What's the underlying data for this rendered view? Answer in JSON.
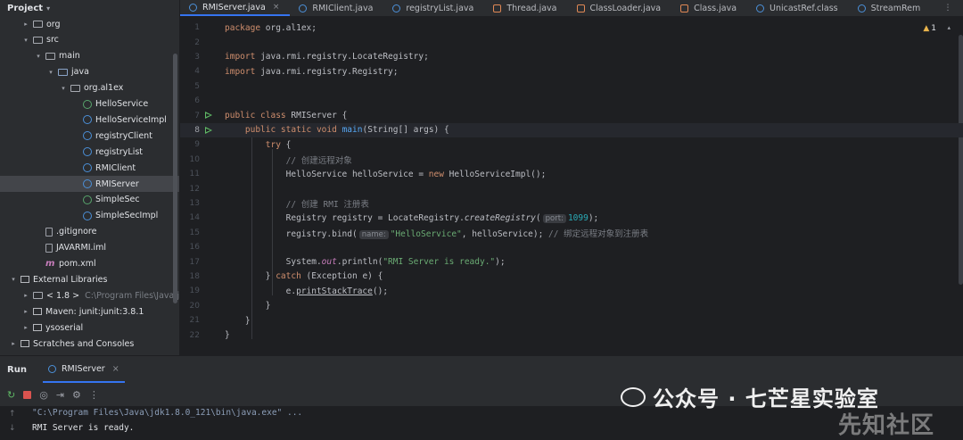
{
  "project": {
    "title": "Project",
    "tree": [
      {
        "label": "org",
        "icon": "folder-icon",
        "indent": 1,
        "arrow": "right",
        "name": "tree-org"
      },
      {
        "label": "src",
        "icon": "folder-icon",
        "indent": 1,
        "arrow": "down",
        "name": "tree-src"
      },
      {
        "label": "main",
        "icon": "folder-icon",
        "indent": 2,
        "arrow": "down",
        "name": "tree-main"
      },
      {
        "label": "java",
        "icon": "source-folder-icon",
        "indent": 3,
        "arrow": "down",
        "name": "tree-java"
      },
      {
        "label": "org.al1ex",
        "icon": "package-icon",
        "indent": 4,
        "arrow": "down",
        "name": "tree-package"
      },
      {
        "label": "HelloService",
        "icon": "interface-icon",
        "indent": 5,
        "arrow": "",
        "name": "tree-HelloService"
      },
      {
        "label": "HelloServiceImpl",
        "icon": "class-icon",
        "indent": 5,
        "arrow": "",
        "name": "tree-HelloServiceImpl"
      },
      {
        "label": "registryClient",
        "icon": "class-icon",
        "indent": 5,
        "arrow": "",
        "name": "tree-registryClient"
      },
      {
        "label": "registryList",
        "icon": "class-icon",
        "indent": 5,
        "arrow": "",
        "name": "tree-registryList"
      },
      {
        "label": "RMIClient",
        "icon": "class-icon",
        "indent": 5,
        "arrow": "",
        "name": "tree-RMIClient"
      },
      {
        "label": "RMIServer",
        "icon": "class-icon",
        "indent": 5,
        "arrow": "",
        "name": "tree-RMIServer",
        "selected": true
      },
      {
        "label": "SimpleSec",
        "icon": "interface-icon",
        "indent": 5,
        "arrow": "",
        "name": "tree-SimpleSec"
      },
      {
        "label": "SimpleSecImpl",
        "icon": "class-icon",
        "indent": 5,
        "arrow": "",
        "name": "tree-SimpleSecImpl"
      },
      {
        "label": ".gitignore",
        "icon": "gitignore-icon",
        "indent": 2,
        "arrow": "",
        "name": "tree-gitignore"
      },
      {
        "label": "JAVARMI.iml",
        "icon": "file-icon",
        "indent": 2,
        "arrow": "",
        "name": "tree-iml"
      },
      {
        "label": "pom.xml",
        "icon": "maven-icon",
        "indent": 2,
        "arrow": "",
        "name": "tree-pom"
      },
      {
        "label": "External Libraries",
        "icon": "library-icon",
        "indent": 0,
        "arrow": "down",
        "name": "tree-external-libraries"
      },
      {
        "label": "< 1.8 >",
        "dim": "C:\\Program Files\\Java\\jdk1",
        "icon": "jdk-icon",
        "indent": 1,
        "arrow": "right",
        "name": "tree-jdk"
      },
      {
        "label": "Maven: junit:junit:3.8.1",
        "icon": "library-icon",
        "indent": 1,
        "arrow": "right",
        "name": "tree-junit"
      },
      {
        "label": "ysoserial",
        "icon": "library-icon",
        "indent": 1,
        "arrow": "right",
        "name": "tree-ysoserial"
      },
      {
        "label": "Scratches and Consoles",
        "icon": "scratches-icon",
        "indent": 0,
        "arrow": "right",
        "name": "tree-scratches"
      }
    ]
  },
  "tabs": [
    {
      "label": "RMIServer.java",
      "active": true,
      "close": "×",
      "icon": "class-icon"
    },
    {
      "label": "RMIClient.java",
      "active": false,
      "icon": "class-icon"
    },
    {
      "label": "registryList.java",
      "active": false,
      "icon": "class-icon"
    },
    {
      "label": "Thread.java",
      "active": false,
      "icon": "class-file-icon"
    },
    {
      "label": "ClassLoader.java",
      "active": false,
      "icon": "class-file-icon"
    },
    {
      "label": "Class.java",
      "active": false,
      "icon": "class-file-icon"
    },
    {
      "label": "UnicastRef.class",
      "active": false,
      "icon": "class-icon"
    },
    {
      "label": "StreamRem",
      "active": false,
      "icon": "class-icon"
    }
  ],
  "editor": {
    "warnings": "1",
    "current_line": 8,
    "lines": [
      [
        [
          "kw",
          "package"
        ],
        [
          "",
          "org.al1ex;"
        ]
      ],
      [],
      [
        [
          "kw",
          "import"
        ],
        [
          "",
          "java.rmi.registry.LocateRegistry;"
        ]
      ],
      [
        [
          "kw",
          "import"
        ],
        [
          "",
          "java.rmi.registry.Registry;"
        ]
      ],
      [],
      [],
      [
        [
          "kw",
          "public class"
        ],
        [
          "",
          "RMIServer {"
        ]
      ],
      [
        [
          "",
          "    "
        ],
        [
          "kw",
          "public static void"
        ],
        [
          "fn",
          "main"
        ],
        [
          "",
          "(String[] args) {"
        ]
      ],
      [
        [
          "",
          "        "
        ],
        [
          "kw",
          "try"
        ],
        [
          "",
          " {"
        ]
      ],
      [
        [
          "",
          "            "
        ],
        [
          "cm",
          "// 创建远程对象"
        ]
      ],
      [
        [
          "",
          "            HelloService helloService = "
        ],
        [
          "kw",
          "new"
        ],
        [
          "",
          " HelloServiceImpl();"
        ]
      ],
      [],
      [
        [
          "",
          "            "
        ],
        [
          "cm",
          "// 创建 RMI 注册表"
        ]
      ],
      [
        [
          "",
          "            Registry registry = LocateRegistry."
        ],
        [
          "it",
          "createRegistry"
        ],
        [
          "",
          "("
        ],
        [
          "hint",
          "port:"
        ],
        [
          "num",
          "1099"
        ],
        [
          "",
          ");"
        ]
      ],
      [
        [
          "",
          "            registry.bind("
        ],
        [
          "hint",
          "name:"
        ],
        [
          "str",
          "\"HelloService\""
        ],
        [
          "",
          ", helloService); "
        ],
        [
          "cm",
          "// 绑定远程对象到注册表"
        ]
      ],
      [],
      [
        [
          "",
          "            System."
        ],
        [
          "st",
          "out"
        ],
        [
          "",
          ".println("
        ],
        [
          "str",
          "\"RMI Server is ready.\""
        ],
        [
          "",
          ");"
        ]
      ],
      [
        [
          "",
          "        } "
        ],
        [
          "kw",
          "catch"
        ],
        [
          "",
          " (Exception e) {"
        ]
      ],
      [
        [
          "",
          "            e."
        ],
        [
          "ul",
          "printStackTrace"
        ],
        [
          "",
          "();"
        ]
      ],
      [
        [
          "",
          "        }"
        ]
      ],
      [
        [
          "",
          "    }"
        ]
      ],
      [
        [
          "",
          "}"
        ]
      ]
    ],
    "run_gutter_lines": [
      7,
      8
    ]
  },
  "run": {
    "label": "Run",
    "tab": "RMIServer",
    "command": "\"C:\\Program Files\\Java\\jdk1.8.0_121\\bin\\java.exe\" ...",
    "output": "RMI Server is ready."
  },
  "watermark": {
    "wechat": "公众号 · 七芒星实验室",
    "site": "先知社区"
  },
  "colors": {
    "accent": "#3574f0",
    "keyword": "#cf8e6d",
    "string": "#6aab73",
    "number": "#2aacb8",
    "comment": "#7a7e85",
    "function": "#56a8f5"
  }
}
